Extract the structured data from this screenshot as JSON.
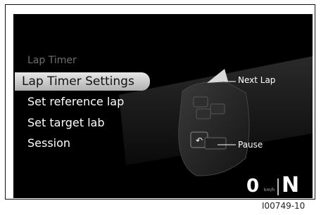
{
  "menu": {
    "title": "Lap Timer",
    "items": [
      {
        "label": "Lap Timer Settings",
        "selected": true
      },
      {
        "label": "Set reference lap",
        "selected": false
      },
      {
        "label": "Set target lab",
        "selected": false
      },
      {
        "label": "Session",
        "selected": false
      }
    ],
    "selected_marker": "◊"
  },
  "callouts": {
    "next_lap": "Next Lap",
    "pause": "Pause"
  },
  "status": {
    "speed": "0",
    "speed_unit": "km/h",
    "gear": "N"
  },
  "reference_code": "I00749-10",
  "colors": {
    "screen_bg": "#000000",
    "selected_bg": "#d0d0d0",
    "text": "#ffffff",
    "muted_text": "#6f6f6f"
  },
  "icons": [
    "back-arrow-icon",
    "switch-cube-icon"
  ]
}
